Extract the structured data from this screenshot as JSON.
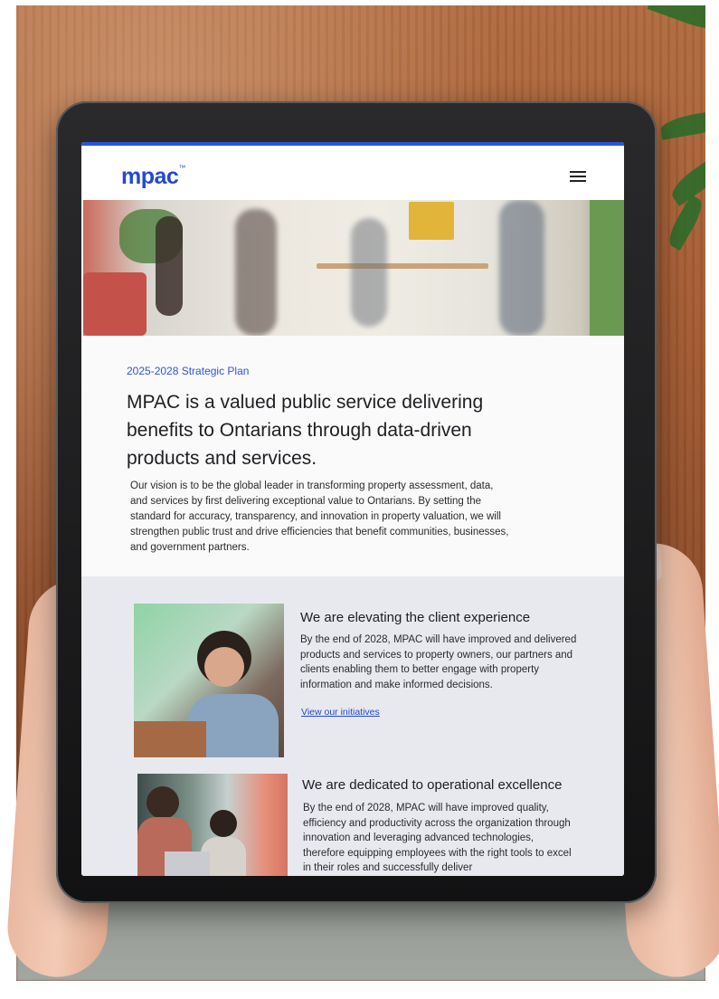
{
  "header": {
    "logo_text": "mpac",
    "logo_mark": "™",
    "menu_icon": "hamburger-menu-icon"
  },
  "intro": {
    "kicker": "2025-2028 Strategic Plan",
    "headline": "MPAC is a valued public service delivering benefits to Ontarians through data-driven products and services.",
    "body": "Our vision is to be the global leader in transforming property assessment, data, and services by first delivering exceptional value to Ontarians. By setting the standard for accuracy, transparency, and innovation in property valuation, we will strengthen public trust and drive efficiencies that benefit communities, businesses, and government partners."
  },
  "cards": [
    {
      "title": "We are elevating the client experience",
      "body": "By the end of 2028, MPAC will have improved and delivered products and services to property owners, our partners and clients enabling them to better engage with property information and make informed decisions.",
      "link": "View our initiatives"
    },
    {
      "title": "We are dedicated to operational excellence",
      "body": "By the end of 2028, MPAC will have improved quality, efficiency and productivity across the organization through innovation and leveraging advanced technologies, therefore equipping employees with the right tools to excel in their roles and successfully deliver"
    }
  ],
  "colors": {
    "accent": "#2d55d9",
    "logo": "#2448d4",
    "section_bg": "#e8e9ef"
  }
}
